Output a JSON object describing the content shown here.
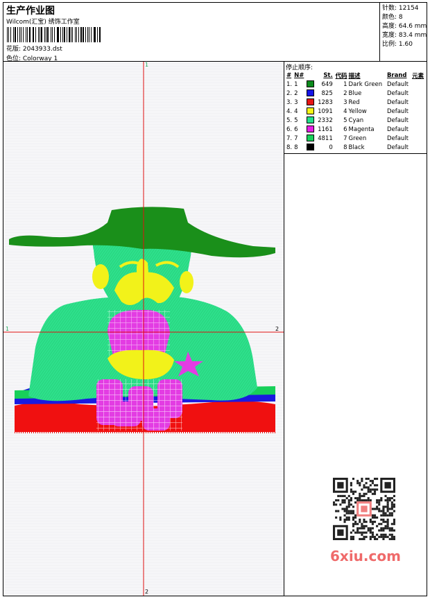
{
  "header": {
    "title": "生产作业图",
    "subtitle": "Wilcom(汇宝) 绣饰工作室",
    "pattern": "花版: 2043933.dst",
    "colorway": "色位: Colorway 1"
  },
  "stats": [
    "针数: 12154",
    "颜色: 8",
    "高度: 64.6 mm",
    "宽度: 83.4 mm",
    "比例: 1.60"
  ],
  "axes": {
    "top": "1",
    "bottom": "2",
    "left": "1",
    "right": "2"
  },
  "stop_sequence": {
    "title": "停止顺序:",
    "headers": [
      "#",
      "N#",
      "St.",
      "代码",
      "描述",
      "Brand",
      "元素"
    ],
    "rows": [
      {
        "idx": "1.",
        "n": "1",
        "color": "#0b8a1c",
        "st": "649",
        "code": "1",
        "desc": "Dark Green",
        "brand": "Default"
      },
      {
        "idx": "2.",
        "n": "2",
        "color": "#1515e6",
        "st": "825",
        "code": "2",
        "desc": "Blue",
        "brand": "Default"
      },
      {
        "idx": "3.",
        "n": "3",
        "color": "#e61515",
        "st": "1283",
        "code": "3",
        "desc": "Red",
        "brand": "Default"
      },
      {
        "idx": "4.",
        "n": "4",
        "color": "#f5f515",
        "st": "1091",
        "code": "4",
        "desc": "Yellow",
        "brand": "Default"
      },
      {
        "idx": "5.",
        "n": "5",
        "color": "#22e08a",
        "st": "2332",
        "code": "5",
        "desc": "Cyan",
        "brand": "Default"
      },
      {
        "idx": "6.",
        "n": "6",
        "color": "#e61ee6",
        "st": "1161",
        "code": "6",
        "desc": "Magenta",
        "brand": "Default"
      },
      {
        "idx": "7.",
        "n": "7",
        "color": "#18d05a",
        "st": "4811",
        "code": "7",
        "desc": "Green",
        "brand": "Default"
      },
      {
        "idx": "8.",
        "n": "8",
        "color": "#000000",
        "st": "0",
        "code": "8",
        "desc": "Black",
        "brand": "Default"
      }
    ]
  },
  "watermark": "6xiu.com",
  "colors": {
    "crosshair": "#e01010",
    "dark_green": "#1a8f1a",
    "cyan_green": "#2ee08c",
    "yellow": "#f2f21a",
    "magenta": "#e33ce3",
    "red": "#f01010",
    "blue": "#1a1ae0"
  }
}
